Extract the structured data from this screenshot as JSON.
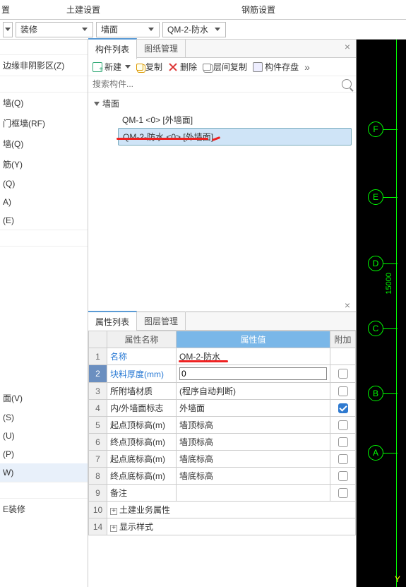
{
  "topTabs": {
    "left_trunc": "置",
    "tab1": "土建设置",
    "tab2": "钢筋设置"
  },
  "toolbar": {
    "dd1_trunc": "",
    "dd2": "装修",
    "dd3": "墙面",
    "dd4": "QM-2-防水"
  },
  "leftSidebar": [
    "边缘非阴影区(Z)",
    "",
    "墙(Q)",
    "门框墙(RF)",
    "墙(Q)",
    "筋(Y)",
    "(Q)",
    "A)",
    "(E)",
    "",
    "",
    "",
    "面(V)",
    "(S)",
    "(U)",
    "(P)",
    "W)",
    "",
    "E装修"
  ],
  "componentPanel": {
    "tabs": {
      "list": "构件列表",
      "drawing": "图纸管理"
    },
    "toolbar": {
      "new": "新建",
      "copy": "复制",
      "delete": "删除",
      "layerCopy": "层间复制",
      "save": "构件存盘"
    },
    "searchPlaceholder": "搜索构件...",
    "tree": {
      "root": "墙面",
      "child1": "QM-1  <0>  [外墙面]",
      "child2": "QM-2-防水  <0>  [外墙面]"
    }
  },
  "propPanel": {
    "tabs": {
      "list": "属性列表",
      "layer": "图层管理"
    },
    "headers": {
      "name": "属性名称",
      "value": "属性值",
      "extra": "附加"
    },
    "rows": [
      {
        "num": "1",
        "name": "名称",
        "value": "QM-2-防水",
        "link": true
      },
      {
        "num": "2",
        "name": "块料厚度(mm)",
        "value": "0",
        "link": true,
        "input": true
      },
      {
        "num": "3",
        "name": "所附墙材质",
        "value": "(程序自动判断)"
      },
      {
        "num": "4",
        "name": "内/外墙面标志",
        "value": "外墙面",
        "checked": true
      },
      {
        "num": "5",
        "name": "起点顶标高(m)",
        "value": "墙顶标高"
      },
      {
        "num": "6",
        "name": "终点顶标高(m)",
        "value": "墙顶标高"
      },
      {
        "num": "7",
        "name": "起点底标高(m)",
        "value": "墙底标高"
      },
      {
        "num": "8",
        "name": "终点底标高(m)",
        "value": "墙底标高"
      },
      {
        "num": "9",
        "name": "备注",
        "value": ""
      },
      {
        "num": "10",
        "name": "土建业务属性",
        "expand": true
      },
      {
        "num": "14",
        "name": "显示样式",
        "expand": true
      }
    ]
  },
  "cad": {
    "bubbles": [
      "F",
      "E",
      "D",
      "C",
      "B",
      "A"
    ],
    "dim1": "15000",
    "axisY": "Y"
  }
}
